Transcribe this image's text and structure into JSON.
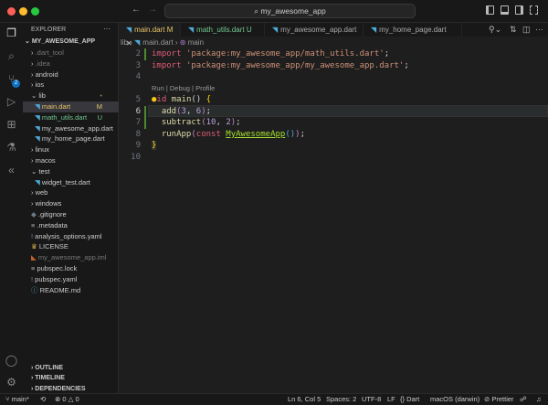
{
  "title": {
    "search": "my_awesome_app"
  },
  "explorer": {
    "header": "EXPLORER",
    "more": "···",
    "root": "MY_AWESOME_APP",
    "items": [
      {
        "label": ".dart_tool",
        "type": "folder",
        "indent": 1,
        "dim": true
      },
      {
        "label": ".idea",
        "type": "folder",
        "indent": 1,
        "dim": true
      },
      {
        "label": "android",
        "type": "folder",
        "indent": 1
      },
      {
        "label": "ios",
        "type": "folder",
        "indent": 1
      },
      {
        "label": "lib",
        "type": "folder-open",
        "indent": 1,
        "badge": "•"
      },
      {
        "label": "main.dart",
        "type": "dart",
        "indent": 2,
        "badge": "M",
        "selected": true
      },
      {
        "label": "math_utils.dart",
        "type": "dart",
        "indent": 2,
        "badge": "U",
        "untracked": true
      },
      {
        "label": "my_awesome_app.dart",
        "type": "dart",
        "indent": 2
      },
      {
        "label": "my_home_page.dart",
        "type": "dart",
        "indent": 2
      },
      {
        "label": "linux",
        "type": "folder",
        "indent": 1
      },
      {
        "label": "macos",
        "type": "folder",
        "indent": 1
      },
      {
        "label": "test",
        "type": "folder-open",
        "indent": 1
      },
      {
        "label": "widget_test.dart",
        "type": "dart",
        "indent": 2
      },
      {
        "label": "web",
        "type": "folder",
        "indent": 1
      },
      {
        "label": "windows",
        "type": "folder",
        "indent": 1
      },
      {
        "label": ".gitignore",
        "type": "git",
        "indent": 1
      },
      {
        "label": ".metadata",
        "type": "file",
        "indent": 1
      },
      {
        "label": "analysis_options.yaml",
        "type": "yaml",
        "indent": 1
      },
      {
        "label": "LICENSE",
        "type": "license",
        "indent": 1
      },
      {
        "label": "my_awesome_app.iml",
        "type": "iml",
        "indent": 1,
        "dim": true
      },
      {
        "label": "pubspec.lock",
        "type": "file",
        "indent": 1
      },
      {
        "label": "pubspec.yaml",
        "type": "yaml",
        "indent": 1
      },
      {
        "label": "README.md",
        "type": "info",
        "indent": 1
      }
    ]
  },
  "panels": {
    "outline": "OUTLINE",
    "timeline": "TIMELINE",
    "dependencies": "DEPENDENCIES"
  },
  "tabs": [
    {
      "label": "main.dart",
      "badge": "M"
    },
    {
      "label": "math_utils.dart",
      "badge": "U"
    },
    {
      "label": "my_awesome_app.dart"
    },
    {
      "label": "my_home_page.dart"
    }
  ],
  "breadcrumb": {
    "folder": "lib",
    "file": "main.dart",
    "symbol": "main"
  },
  "editor": {
    "codelens": "Run | Debug | Profile",
    "line_numbers": [
      "2",
      "3",
      "4",
      "5",
      "6",
      "7",
      "8",
      "9",
      "10"
    ]
  },
  "source_control_badge": "2",
  "status": {
    "branch": "main*",
    "errors": "0",
    "warnings": "0",
    "position": "Ln 6, Col 5",
    "spaces": "Spaces: 2",
    "encoding": "UTF-8",
    "eol": "LF",
    "language": "Dart",
    "platform": "macOS (darwin)",
    "formatter": "Prettier"
  }
}
